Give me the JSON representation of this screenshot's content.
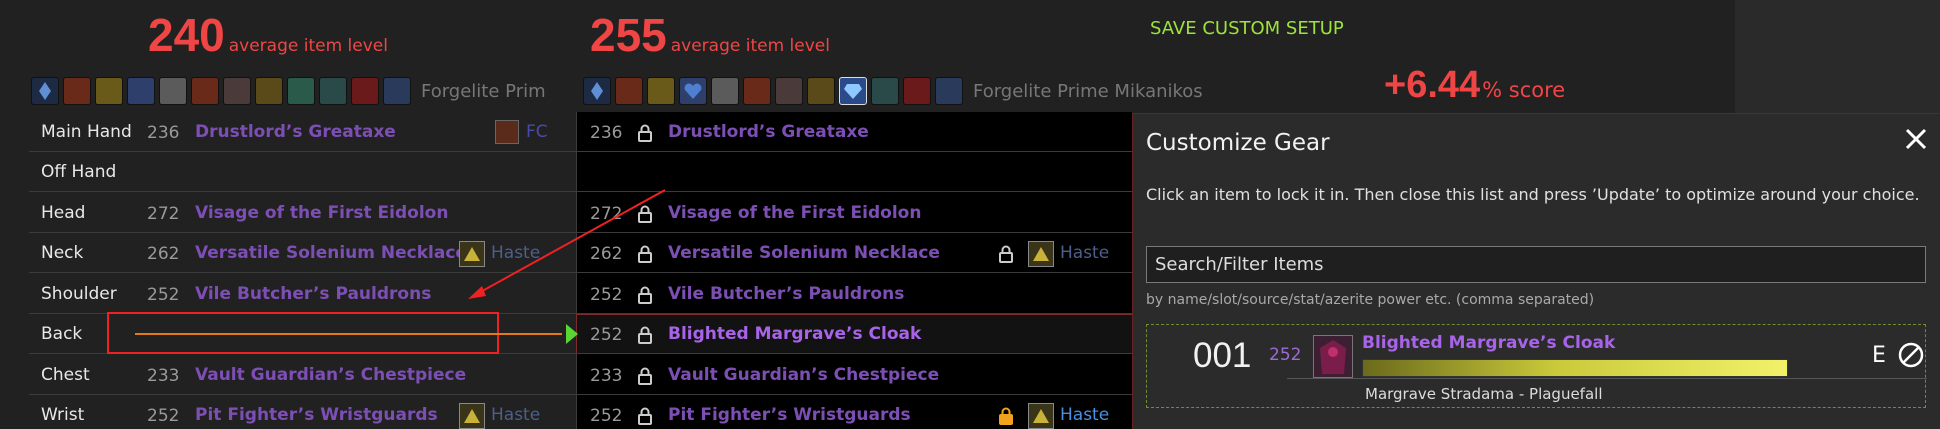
{
  "header": {
    "left_ilvl": "240",
    "right_ilvl": "255",
    "ilvl_label": "average item level",
    "save_label": "SAVE CUSTOM SETUP",
    "left_character": "Forgelite Prim",
    "right_character": "Forgelite Prime Mikanikos",
    "score_value": "+6.44",
    "score_label": "% score"
  },
  "slots": [
    {
      "slot": "Main Hand",
      "left_lv": "236",
      "left_item": "Drustlord’s Greataxe",
      "left_extra": "FC",
      "right_lv": "236",
      "right_item": "Drustlord’s Greataxe"
    },
    {
      "slot": "Off Hand",
      "left_lv": "",
      "left_item": "",
      "right_lv": "",
      "right_item": ""
    },
    {
      "slot": "Head",
      "left_lv": "272",
      "left_item": "Visage of the First Eidolon",
      "right_lv": "272",
      "right_item": "Visage of the First Eidolon"
    },
    {
      "slot": "Neck",
      "left_lv": "262",
      "left_item": "Versatile Solenium Necklace",
      "left_stat": "Haste",
      "right_lv": "262",
      "right_item": "Versatile Solenium Necklace",
      "right_stat": "Haste"
    },
    {
      "slot": "Shoulder",
      "left_lv": "252",
      "left_item": "Vile Butcher’s Pauldrons",
      "right_lv": "252",
      "right_item": "Vile Butcher’s Pauldrons"
    },
    {
      "slot": "Back",
      "left_lv": "",
      "left_item": "",
      "right_lv": "252",
      "right_item": "Blighted Margrave’s Cloak"
    },
    {
      "slot": "Chest",
      "left_lv": "233",
      "left_item": "Vault Guardian’s Chestpiece",
      "right_lv": "233",
      "right_item": "Vault Guardian’s Chestpiece"
    },
    {
      "slot": "Wrist",
      "left_lv": "252",
      "left_item": "Pit Fighter’s Wristguards",
      "left_stat": "Haste",
      "right_lv": "252",
      "right_item": "Pit Fighter’s Wristguards",
      "right_stat": "Haste"
    }
  ],
  "panel": {
    "title": "Customize Gear",
    "instructions": "Click an item to lock it in. Then close this list and press ’Update’ to optimize around your choice.",
    "search_value": "Search/Filter Items",
    "search_hint": "by name/slot/source/stat/azerite power etc. (comma separated)",
    "result": {
      "rank": "001",
      "ilvl": "252",
      "name": "Blighted Margrave’s Cloak",
      "source": "Margrave Stradama - Plaguefall",
      "equip_letter": "E",
      "score_fraction": 1.0
    }
  },
  "colors": {
    "accent_red": "#ef4645",
    "save_green": "#9ee33b",
    "epic_purple": "#a864e8",
    "stat_blue": "#4a8fe0"
  }
}
